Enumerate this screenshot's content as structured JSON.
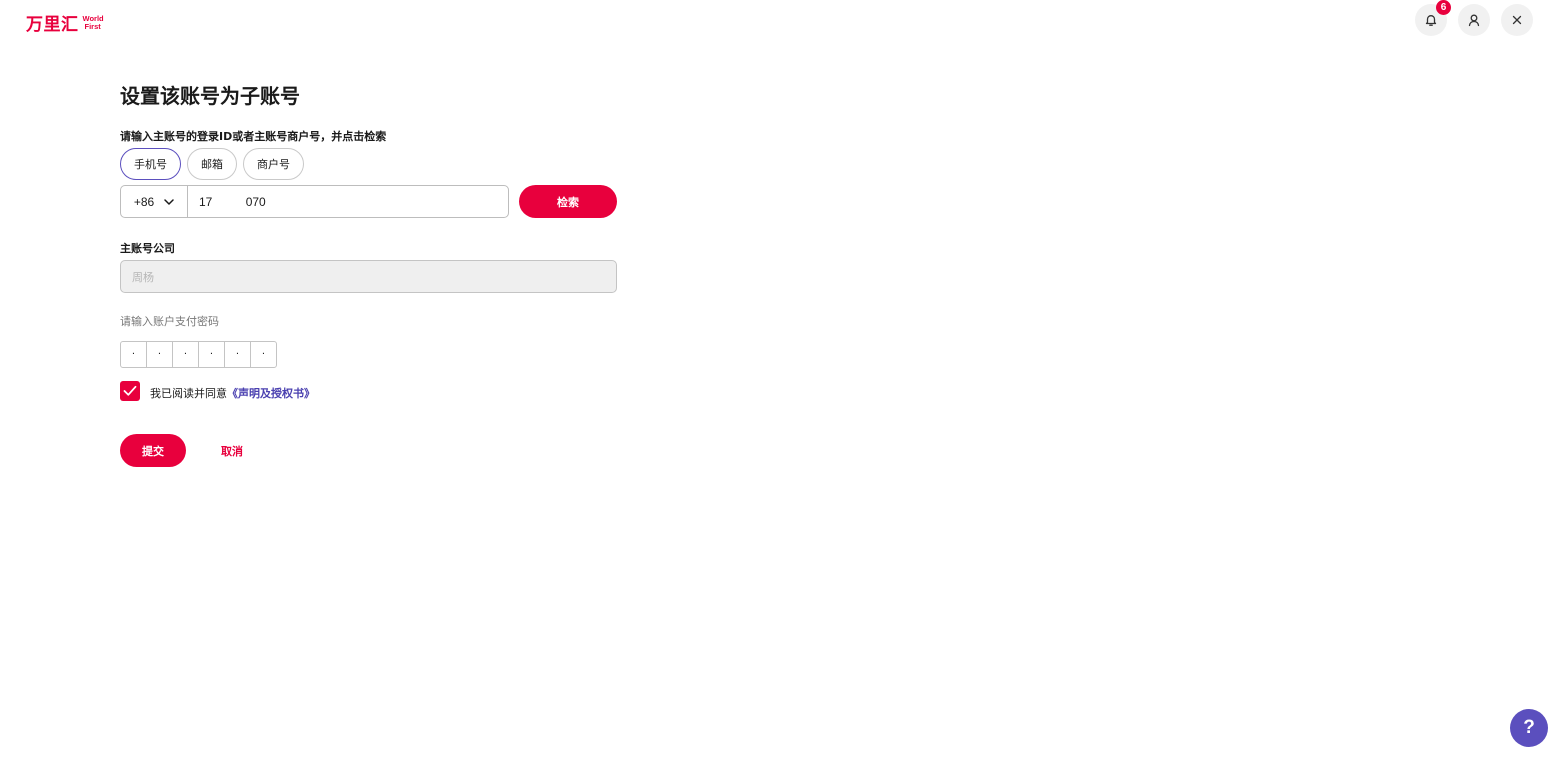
{
  "header": {
    "logo_cn": "万里汇",
    "logo_en_line1": "World",
    "logo_en_line2": "First",
    "notifications": {
      "count": "6",
      "icon": "bell-icon"
    },
    "profile_icon": "user-icon",
    "close_icon": "close-icon"
  },
  "form": {
    "title": "设置该账号为子账号",
    "instruction": "请输入主账号的登录ID或者主账号商户号，并点击检索",
    "tabs": [
      {
        "label": "手机号",
        "active": true
      },
      {
        "label": "邮箱",
        "active": false
      },
      {
        "label": "商户号",
        "active": false
      }
    ],
    "country_code": "+86",
    "phone_value": "17          070",
    "search_label": "检索",
    "company_label": "主账号公司",
    "company_value": "周杨",
    "password_label": "请输入账户支付密码",
    "pin_digits": [
      "·",
      "·",
      "·",
      "·",
      "·",
      "·"
    ],
    "agree_text": "我已阅读并同意",
    "agree_link": "《声明及授权书》",
    "agree_checked": true,
    "submit_label": "提交",
    "cancel_label": "取消"
  },
  "help": {
    "label": "?"
  },
  "colors": {
    "brand": "#e8003d",
    "accent": "#5b4fbe",
    "link": "#4a40b0"
  }
}
